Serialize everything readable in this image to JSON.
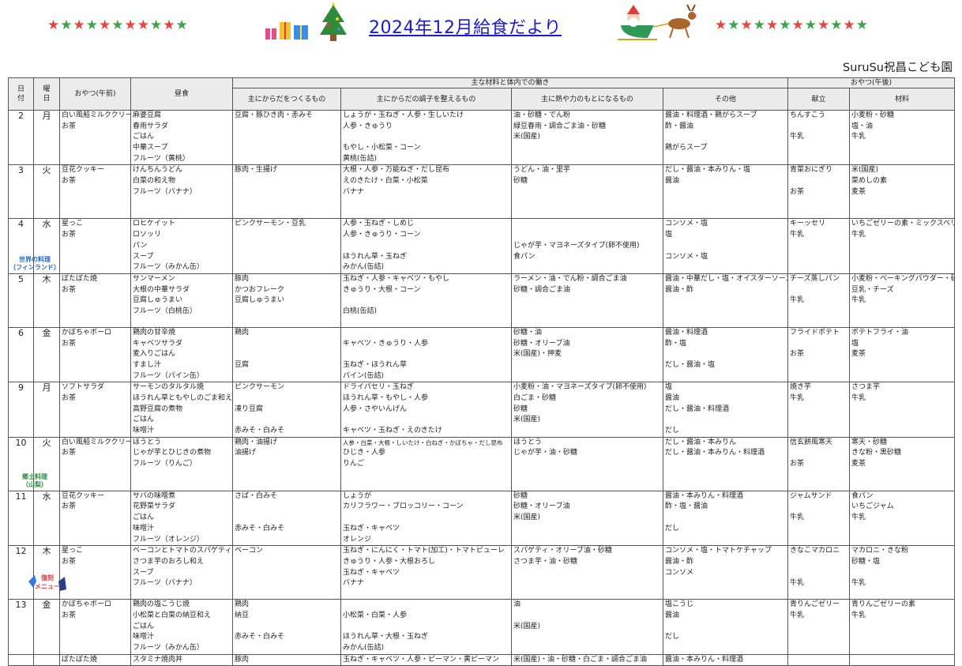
{
  "header": {
    "title": "2024年12月給食だより",
    "school": "SuruSu祝昌こども園",
    "stars_left": [
      "r",
      "g",
      "r",
      "g",
      "r",
      "g",
      "r",
      "r",
      "g",
      "r",
      "g"
    ],
    "stars_right": [
      "r",
      "g",
      "r",
      "g",
      "r",
      "g",
      "r",
      "g",
      "r",
      "g",
      "r",
      "g"
    ]
  },
  "columns": {
    "date": "日\n付",
    "weekday": "曜\n日",
    "snack_am": "おやつ(午前)",
    "lunch": "昼食",
    "main_group": "主な材料と体内での働き",
    "red": "主にからだをつくるもの",
    "green": "主にからだの調子を整えるもの",
    "yellow": "主に熱や力のもとになるもの",
    "other": "その他",
    "snack_pm_group": "おやつ(午後)",
    "pm_menu": "献立",
    "pm_ingredients": "材料"
  },
  "colors": {
    "red_header": "#ee99ee",
    "green_header": "#b6f3b6",
    "yellow_header": "#fafa90",
    "title": "#1a1ad6"
  },
  "rows": [
    {
      "day": "2",
      "wd": "月",
      "note": "",
      "am": [
        "白い風船ミルククリーム",
        "お茶"
      ],
      "lunch": [
        "麻婆豆腐",
        "春雨サラダ",
        "ごはん",
        "中華スープ",
        "フルーツ（黄桃）"
      ],
      "red": [
        "豆腐・豚ひき肉・赤みそ"
      ],
      "green": [
        "しょうが・玉ねぎ・人参・生しいたけ",
        "人参・きゅうり",
        "",
        "もやし・小松菜・コーン",
        "黄桃(缶詰)"
      ],
      "yellow": [
        "油・砂糖・でん粉",
        "緑豆春雨・調合ごま油・砂糖",
        "米(国産)"
      ],
      "other": [
        "醤油・料理酒・鶏がらスープ",
        "酢・醤油",
        "",
        "鶏がらスープ"
      ],
      "pm_menu": [
        "ちんすこう",
        "",
        "牛乳"
      ],
      "pm_ing": [
        "小麦粉・砂糖",
        "塩・油",
        "牛乳"
      ]
    },
    {
      "day": "3",
      "wd": "火",
      "note": "",
      "am": [
        "豆花クッキー",
        "お茶"
      ],
      "lunch": [
        "けんちんうどん",
        "白菜の和え物",
        "フルーツ（バナナ）"
      ],
      "red": [
        "豚肉・生揚げ"
      ],
      "green": [
        "大根・人参・万能ねぎ・だし昆布",
        "えのきたけ・白菜・小松菜",
        "バナナ"
      ],
      "yellow": [
        "うどん・油・里芋",
        "砂糖"
      ],
      "other": [
        "だし・醤油・本みりん・塩",
        "醤油"
      ],
      "pm_menu": [
        "青菜おにぎり",
        "",
        "お茶"
      ],
      "pm_ing": [
        "米(国産)",
        "菜めしの素",
        "麦茶"
      ]
    },
    {
      "day": "4",
      "wd": "水",
      "note": "世界の料理\n（フィンランド）",
      "noteClass": "blue",
      "am": [
        "星っこ",
        "お茶"
      ],
      "lunch": [
        "ロヒケイット",
        "ロソッリ",
        "パン",
        "スープ",
        "フルーツ（みかん缶）"
      ],
      "red": [
        "ピンクサーモン・豆乳"
      ],
      "green": [
        "人参・玉ねぎ・しめじ",
        "人参・きゅうり・コーン",
        "",
        "ほうれん草・玉ねぎ",
        "みかん(缶詰)"
      ],
      "yellow": [
        "",
        "",
        "じゃが芋・マヨネーズタイプ(卵不使用)",
        "食パン"
      ],
      "other": [
        "コンソメ・塩",
        "塩",
        "",
        "コンソメ・塩"
      ],
      "pm_menu": [
        "キーッセリ",
        "牛乳"
      ],
      "pm_ing": [
        "いちごゼリーの素・ミックスベリー",
        "牛乳"
      ]
    },
    {
      "day": "5",
      "wd": "木",
      "note": "",
      "am": [
        "ぼたぼた焼",
        "お茶"
      ],
      "lunch": [
        "サンマーメン",
        "大根の中華サラダ",
        "豆腐しゅうまい",
        "フルーツ（白桃缶）"
      ],
      "red": [
        "豚肉",
        "かつおフレーク",
        "豆腐しゅうまい"
      ],
      "green": [
        "玉ねぎ・人参・キャベツ・もやし",
        "きゅうり・大根・コーン",
        "",
        "白桃(缶詰)"
      ],
      "yellow": [
        "ラーメン・油・でん粉・調合ごま油",
        "砂糖・調合ごま油"
      ],
      "other": [
        "醤油・中華だし・塩・オイスターソース",
        "醤油・酢"
      ],
      "pm_menu": [
        "チーズ蒸しパン",
        "",
        "牛乳"
      ],
      "pm_ing": [
        "小麦粉・ベーキングパウダー・砂糖",
        "豆乳・チーズ",
        "牛乳"
      ]
    },
    {
      "day": "6",
      "wd": "金",
      "note": "",
      "am": [
        "かぼちゃボーロ",
        "お茶"
      ],
      "lunch": [
        "鶏肉の甘辛焼",
        "キャベツサラダ",
        "麦入りごはん",
        "すまし汁",
        "フルーツ（パイン缶）"
      ],
      "red": [
        "鶏肉",
        "",
        "",
        "豆腐"
      ],
      "green": [
        "",
        "キャベツ・きゅうり・人参",
        "",
        "玉ねぎ・ほうれん草",
        "パイン(缶詰)"
      ],
      "yellow": [
        "砂糖・油",
        "砂糖・オリーブ油",
        "米(国産)・押麦"
      ],
      "other": [
        "醤油・料理酒",
        "酢・塩",
        "",
        "だし・醤油・塩"
      ],
      "pm_menu": [
        "フライドポテト",
        "",
        "お茶"
      ],
      "pm_ing": [
        "ポテトフライ・油",
        "塩",
        "麦茶"
      ]
    },
    {
      "day": "9",
      "wd": "月",
      "note": "",
      "am": [
        "ソフトサラダ",
        "お茶"
      ],
      "lunch": [
        "サーモンのタルタル焼",
        "ほうれん草ともやしのごま和え",
        "高野豆腐の煮物",
        "ごはん",
        "味噌汁"
      ],
      "red": [
        "ピンクサーモン",
        "",
        "凍り豆腐",
        "",
        "赤みそ・白みそ"
      ],
      "green": [
        "ドライパセリ・玉ねぎ",
        "ほうれん草・もやし・人参",
        "人参・さやいんげん",
        "",
        "キャベツ・玉ねぎ・えのきたけ"
      ],
      "yellow": [
        "小麦粉・油・マヨネーズタイプ(卵不使用)",
        "白ごま・砂糖",
        "砂糖",
        "米(国産)"
      ],
      "other": [
        "塩",
        "醤油",
        "だし・醤油・料理酒",
        "",
        "だし"
      ],
      "pm_menu": [
        "焼き芋",
        "牛乳"
      ],
      "pm_ing": [
        "さつま芋",
        "牛乳"
      ]
    },
    {
      "day": "10",
      "wd": "火",
      "note": "郷土料理\n（山梨）",
      "noteClass": "",
      "am": [
        "白い風船ミルククリーム",
        "お茶"
      ],
      "lunch": [
        "ほうとう",
        "じゃが芋とひじきの煮物",
        "フルーツ（りんご）"
      ],
      "red": [
        "鶏肉・油揚げ",
        "油揚げ"
      ],
      "green": [
        "人参・白菜・大根・しいたけ・白ねぎ・かぼちゃ・だし昆布",
        "ひじき・人参",
        "りんご"
      ],
      "yellow": [
        "ほうとう",
        "じゃが芋・油・砂糖"
      ],
      "other": [
        "だし・醤油・本みりん",
        "だし・醤油・本みりん・料理酒"
      ],
      "pm_menu": [
        "信玄餅風寒天",
        "",
        "お茶"
      ],
      "pm_ing": [
        "寒天・砂糖",
        "きな粉・黒砂糖",
        "麦茶"
      ]
    },
    {
      "day": "11",
      "wd": "水",
      "note": "",
      "am": [
        "豆花クッキー",
        "お茶"
      ],
      "lunch": [
        "サバの味噌煮",
        "花野菜サラダ",
        "ごはん",
        "味噌汁",
        "フルーツ（オレンジ）"
      ],
      "red": [
        "さば・白みそ",
        "",
        "",
        "赤みそ・白みそ"
      ],
      "green": [
        "しょうが",
        "カリフラワー・ブロッコリー・コーン",
        "",
        "玉ねぎ・キャベツ",
        "オレンジ"
      ],
      "yellow": [
        "砂糖",
        "砂糖・オリーブ油",
        "米(国産)"
      ],
      "other": [
        "醤油・本みりん・料理酒",
        "酢・塩・醤油",
        "",
        "だし"
      ],
      "pm_menu": [
        "ジャムサンド",
        "",
        "牛乳"
      ],
      "pm_ing": [
        "食パン",
        "いちごジャム",
        "牛乳"
      ]
    },
    {
      "day": "12",
      "wd": "木",
      "note": "",
      "am": [
        "星っこ",
        "お茶"
      ],
      "lunch": [
        "ベーコンとトマトのスパゲティ",
        "さつま芋のおろし和え",
        "スープ",
        "フルーツ（バナナ）"
      ],
      "red": [
        "ベーコン"
      ],
      "green": [
        "玉ねぎ・にんにく・トマト(加工)・トマトピューレ",
        "きゅうり・人参・大根おろし",
        "玉ねぎ・キャベツ",
        "バナナ"
      ],
      "yellow": [
        "スパゲティ・オリーブ油・砂糖",
        "さつま芋・油・砂糖"
      ],
      "other": [
        "コンソメ・塩・トマトケチャップ",
        "醤油・酢",
        "コンソメ"
      ],
      "pm_menu": [
        "きなこマカロニ",
        "",
        "",
        "牛乳"
      ],
      "pm_ing": [
        "マカロニ・きな粉",
        "砂糖・塩",
        "",
        "牛乳"
      ]
    },
    {
      "day": "13",
      "wd": "金",
      "note": "",
      "am": [
        "かぼちゃボーロ",
        "お茶"
      ],
      "lunch": [
        "鶏肉の塩こうじ焼",
        "小松菜と白菜の納豆和え",
        "ごはん",
        "味噌汁",
        "フルーツ（みかん缶）"
      ],
      "red": [
        "鶏肉",
        "納豆",
        "",
        "赤みそ・白みそ"
      ],
      "green": [
        "",
        "小松菜・白菜・人参",
        "",
        "ほうれん草・大根・玉ねぎ",
        "みかん(缶詰)"
      ],
      "yellow": [
        "油",
        "",
        "米(国産)"
      ],
      "other": [
        "塩こうじ",
        "醤油",
        "",
        "だし"
      ],
      "pm_menu": [
        "青りんごゼリー",
        "牛乳"
      ],
      "pm_ing": [
        "青りんごゼリーの素",
        "牛乳"
      ]
    },
    {
      "day": "",
      "wd": "",
      "note": "",
      "am": [
        "ぼたぼた焼"
      ],
      "lunch": [
        "スタミナ焼肉丼"
      ],
      "red": [
        "豚肉"
      ],
      "green": [
        "玉ねぎ・キャベツ・人参・ピーマン・黄ピーマン"
      ],
      "yellow": [
        "米(国産)・油・砂糖・白ごま・調合ごま油"
      ],
      "other": [
        "醤油・本みりん・料理酒"
      ],
      "pm_menu": [
        ""
      ],
      "pm_ing": [
        ""
      ]
    }
  ],
  "revival_badge": "復刻\nメニュー"
}
